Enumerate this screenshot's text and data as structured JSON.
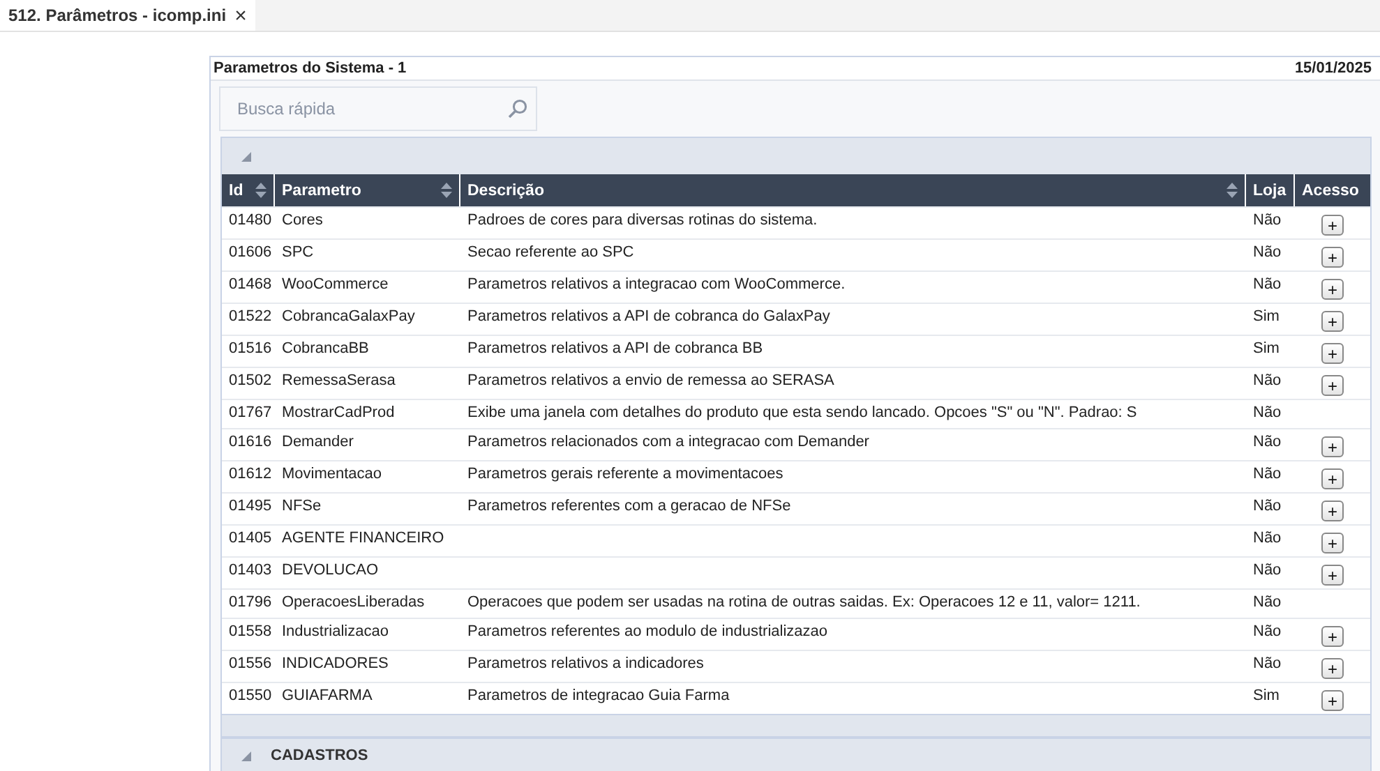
{
  "tab": {
    "label": "512. Parâmetros - icomp.ini",
    "close": "×"
  },
  "panel": {
    "title": "Parametros do Sistema - 1",
    "date": "15/01/2025"
  },
  "search": {
    "placeholder": "Busca rápida"
  },
  "table": {
    "columns": [
      {
        "label": "Id",
        "sortable": true
      },
      {
        "label": "Parametro",
        "sortable": true
      },
      {
        "label": "Descrição",
        "sortable": true
      },
      {
        "label": "Loja"
      },
      {
        "label": "Acesso"
      }
    ],
    "rows": [
      {
        "id": "01480",
        "name": "Cores",
        "description": "Padroes de cores para diversas rotinas do sistema.",
        "loja": "Não",
        "access": "+"
      },
      {
        "id": "01606",
        "name": "SPC",
        "description": "Secao referente ao SPC",
        "loja": "Não",
        "access": "+"
      },
      {
        "id": "01468",
        "name": "WooCommerce",
        "description": "Parametros relativos a integracao com WooCommerce.",
        "loja": "Não",
        "access": "+"
      },
      {
        "id": "01522",
        "name": "CobrancaGalaxPay",
        "description": "Parametros relativos a API de cobranca do GalaxPay",
        "loja": "Sim",
        "access": "+"
      },
      {
        "id": "01516",
        "name": "CobrancaBB",
        "description": "Parametros relativos a API de cobranca BB",
        "loja": "Sim",
        "access": "+"
      },
      {
        "id": "01502",
        "name": "RemessaSerasa",
        "description": "Parametros relativos a envio de remessa ao SERASA",
        "loja": "Não",
        "access": "+"
      },
      {
        "id": "01767",
        "name": "MostrarCadProd",
        "description": "Exibe uma janela com detalhes do produto que esta sendo lancado. Opcoes \"S\" ou \"N\". Padrao: S",
        "loja": "Não"
      },
      {
        "id": "01616",
        "name": "Demander",
        "description": "Parametros relacionados com a integracao com Demander",
        "loja": "Não",
        "access": "+"
      },
      {
        "id": "01612",
        "name": "Movimentacao",
        "description": "Parametros gerais referente a movimentacoes",
        "loja": "Não",
        "access": "+"
      },
      {
        "id": "01495",
        "name": "NFSe",
        "description": "Parametros referentes com a geracao de NFSe",
        "loja": "Não",
        "access": "+"
      },
      {
        "id": "01405",
        "name": "AGENTE FINANCEIRO",
        "loja": "Não",
        "access": "+"
      },
      {
        "id": "01403",
        "name": "DEVOLUCAO",
        "loja": "Não",
        "access": "+"
      },
      {
        "id": "01796",
        "name": "OperacoesLiberadas",
        "description": "Operacoes que podem ser usadas na rotina de outras saidas. Ex: Operacoes 12 e 11, valor= 1211.",
        "loja": "Não"
      },
      {
        "id": "01558",
        "name": "Industrializacao",
        "description": "Parametros referentes ao modulo de industrializazao",
        "loja": "Não",
        "access": "+"
      },
      {
        "id": "01556",
        "name": "INDICADORES",
        "description": "Parametros relativos a indicadores",
        "loja": "Não",
        "access": "+"
      },
      {
        "id": "01550",
        "name": "GUIAFARMA",
        "description": "Parametros de integracao Guia Farma",
        "loja": "Sim",
        "access": "+"
      }
    ]
  },
  "next_group": {
    "label": "CADASTROS",
    "expanded": true
  }
}
